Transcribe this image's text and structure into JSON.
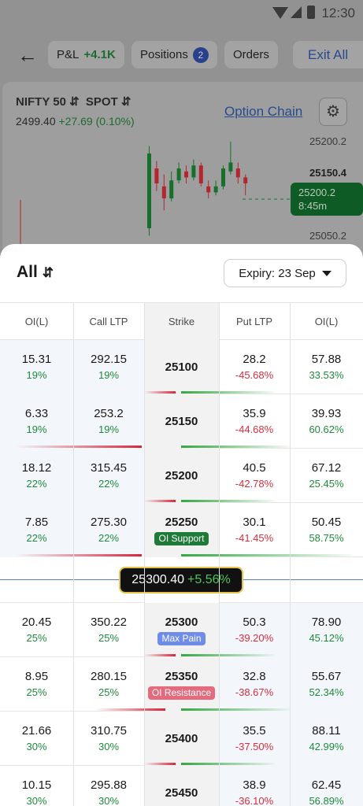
{
  "status": {
    "time": "12:30"
  },
  "topbar": {
    "pnl_label": "P&L",
    "pnl_value": "+4.1K",
    "positions_label": "Positions",
    "positions_count": "2",
    "orders_label": "Orders",
    "exit_label": "Exit All"
  },
  "chart": {
    "symbol": "NIFTY 50",
    "mode": "SPOT",
    "price": "2499.40",
    "change": "+27.69 (0.10%)",
    "option_chain": "Option Chain",
    "y_ticks": [
      "25200.2",
      "25150.4",
      "25050.2"
    ],
    "current_price": "25200.2",
    "current_time": "8:45m"
  },
  "chart_data": {
    "type": "candlestick",
    "candles": [
      {
        "o": 10,
        "c": 60,
        "h": 65,
        "l": 5,
        "up": true
      },
      {
        "o": 50,
        "c": 40,
        "h": 55,
        "l": 35,
        "up": false
      },
      {
        "o": 38,
        "c": 30,
        "h": 46,
        "l": 22,
        "up": false
      },
      {
        "o": 30,
        "c": 42,
        "h": 48,
        "l": 28,
        "up": true
      },
      {
        "o": 42,
        "c": 50,
        "h": 54,
        "l": 40,
        "up": true
      },
      {
        "o": 48,
        "c": 44,
        "h": 52,
        "l": 40,
        "up": false
      },
      {
        "o": 44,
        "c": 52,
        "h": 56,
        "l": 42,
        "up": true
      },
      {
        "o": 52,
        "c": 40,
        "h": 54,
        "l": 38,
        "up": false
      },
      {
        "o": 38,
        "c": 34,
        "h": 42,
        "l": 30,
        "up": false
      },
      {
        "o": 34,
        "c": 38,
        "h": 42,
        "l": 32,
        "up": true
      },
      {
        "o": 38,
        "c": 50,
        "h": 52,
        "l": 36,
        "up": true
      },
      {
        "o": 48,
        "c": 54,
        "h": 68,
        "l": 46,
        "up": true
      },
      {
        "o": 50,
        "c": 44,
        "h": 54,
        "l": 40,
        "up": false
      },
      {
        "o": 44,
        "c": 40,
        "h": 46,
        "l": 32,
        "up": false
      }
    ]
  },
  "filter": {
    "label": "All"
  },
  "expiry": {
    "label": "Expiry: 23 Sep"
  },
  "headers": [
    "OI(L)",
    "Call LTP",
    "Strike",
    "Put LTP",
    "OI(L)"
  ],
  "rows": [
    {
      "coi": "15.31",
      "coi_pct": "19%",
      "cltp": "292.15",
      "cltp_pct": "19%",
      "strike": "25100",
      "tag": "",
      "pltp": "28.2",
      "pltp_pct": "-45.68%",
      "poi": "57.88",
      "poi_pct": "33.53%"
    },
    {
      "coi": "6.33",
      "coi_pct": "19%",
      "cltp": "253.2",
      "cltp_pct": "19%",
      "strike": "25150",
      "tag": "",
      "pltp": "35.9",
      "pltp_pct": "-44.68%",
      "poi": "39.93",
      "poi_pct": "60.62%"
    },
    {
      "coi": "18.12",
      "coi_pct": "22%",
      "cltp": "315.45",
      "cltp_pct": "22%",
      "strike": "25200",
      "tag": "",
      "pltp": "40.5",
      "pltp_pct": "-42.78%",
      "poi": "67.12",
      "poi_pct": "25.45%"
    },
    {
      "coi": "7.85",
      "coi_pct": "22%",
      "cltp": "275.30",
      "cltp_pct": "22%",
      "strike": "25250",
      "tag": "OI Support",
      "pltp": "30.1",
      "pltp_pct": "-41.45%",
      "poi": "50.45",
      "poi_pct": "58.75%"
    },
    {
      "coi": "20.45",
      "coi_pct": "25%",
      "cltp": "350.22",
      "cltp_pct": "25%",
      "strike": "25300",
      "tag": "Max Pain",
      "pltp": "50.3",
      "pltp_pct": "-39.20%",
      "poi": "78.90",
      "poi_pct": "45.12%"
    },
    {
      "coi": "8.95",
      "coi_pct": "25%",
      "cltp": "280.15",
      "cltp_pct": "25%",
      "strike": "25350",
      "tag": "OI Resistance",
      "pltp": "32.8",
      "pltp_pct": "-38.67%",
      "poi": "55.67",
      "poi_pct": "52.34%"
    },
    {
      "coi": "21.66",
      "coi_pct": "30%",
      "cltp": "310.75",
      "cltp_pct": "30%",
      "strike": "25400",
      "tag": "",
      "pltp": "35.5",
      "pltp_pct": "-37.50%",
      "poi": "88.11",
      "poi_pct": "42.99%"
    },
    {
      "coi": "10.15",
      "coi_pct": "30%",
      "cltp": "295.88",
      "cltp_pct": "30%",
      "strike": "25450",
      "tag": "",
      "pltp": "38.9",
      "pltp_pct": "-36.10%",
      "poi": "62.45",
      "poi_pct": "56.89%"
    }
  ],
  "spot": {
    "price": "25300.40",
    "change": "+5.56%"
  },
  "colors": {
    "support": "#1d7a37",
    "max_pain": "#6f8de8",
    "resistance": "#e46a7d",
    "up": "#1f8a3b",
    "down": "#d32f3c"
  }
}
